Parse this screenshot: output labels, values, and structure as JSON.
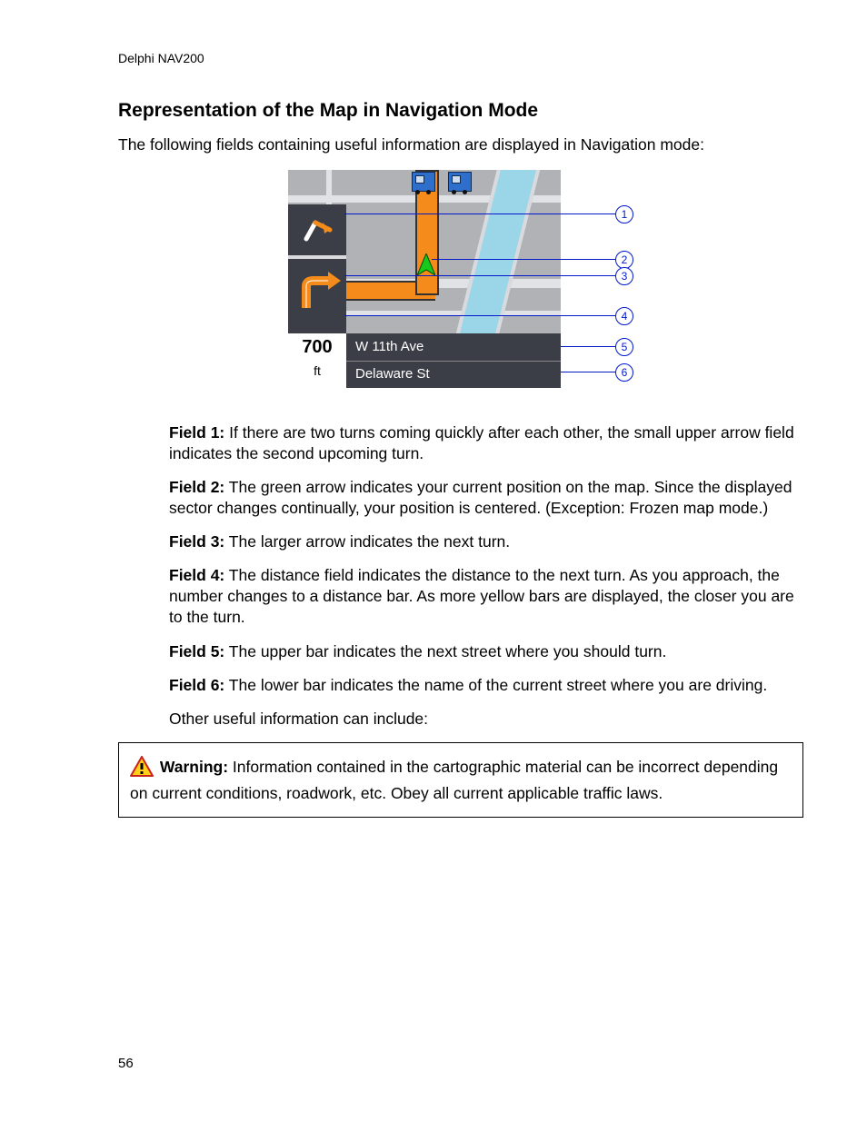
{
  "header": "Delphi NAV200",
  "section_title": "Representation of the Map in Navigation Mode",
  "intro": "The following fields containing useful information are displayed in Navigation mode:",
  "nav_figure": {
    "distance_value": "700",
    "distance_unit": "ft",
    "street_next": "W 11th Ave",
    "street_current": "Delaware St",
    "callouts": [
      "1",
      "2",
      "3",
      "4",
      "5",
      "6"
    ]
  },
  "fields": [
    {
      "label": "Field 1:",
      "text": " If there are two turns coming quickly after each other, the small upper arrow field indicates the second upcoming turn."
    },
    {
      "label": "Field 2:",
      "text": " The green arrow indicates your current position on the map. Since the displayed sector changes continually, your position is centered. (Exception: Frozen map mode.)"
    },
    {
      "label": "Field 3:",
      "text": " The larger arrow indicates the next turn."
    },
    {
      "label": "Field 4:",
      "text": " The distance field indicates the distance to the next turn. As you approach, the number changes to a distance bar. As more yellow bars are displayed, the closer you are to the turn."
    },
    {
      "label": "Field 5:",
      "text": " The upper bar indicates the next street where you should turn."
    },
    {
      "label": "Field 6:",
      "text": " The lower bar indicates the name of the current street where you are driving."
    }
  ],
  "other_info": "Other useful information can include:",
  "warning": {
    "label": "Warning:",
    "text": " Information contained in the cartographic material can be incorrect depending on current conditions, roadwork, etc. Obey all current applicable traffic laws."
  },
  "page_number": "56"
}
